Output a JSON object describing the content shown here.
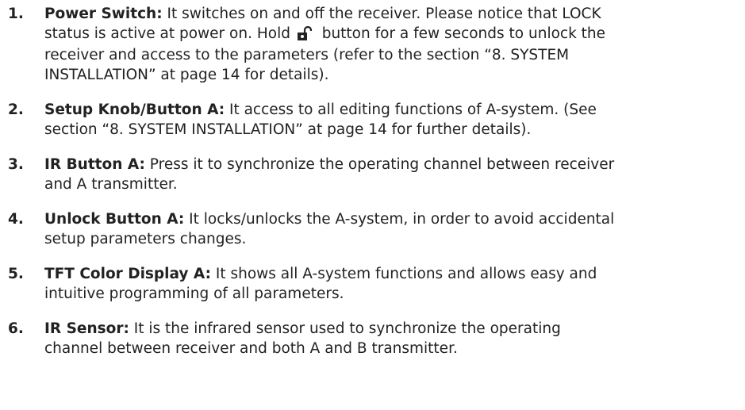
{
  "items": [
    {
      "number": "1.",
      "term": "Power Switch:",
      "text_before_icon": " It switches on and off the receiver. Please notice that LOCK status is active at power on. Hold ",
      "icon": "unlock-icon",
      "text_after_icon": " button for a few seconds to unlock the receiver and access to the parameters (refer to the section “8. SYSTEM INSTALLATION” at page 14 for details)."
    },
    {
      "number": "2.",
      "term": "Setup Knob/Button A:",
      "text": " It access to all editing functions of A-system. (See section “8. SYSTEM INSTALLATION” at page 14 for further details)."
    },
    {
      "number": "3.",
      "term": "IR Button A:",
      "text": " Press it to synchronize the operating channel between receiver and A transmitter."
    },
    {
      "number": "4.",
      "term": "Unlock Button A:",
      "text": " It locks/unlocks the A-system, in order to avoid accidental setup parameters changes."
    },
    {
      "number": "5.",
      "term": "TFT Color Display A:",
      "text": " It shows all A-system functions and allows easy and intuitive programming of all parameters."
    },
    {
      "number": "6.",
      "term": "IR Sensor:",
      "text": " It is the infrared sensor used to synchronize the operating channel between receiver and both A and B transmitter."
    }
  ]
}
